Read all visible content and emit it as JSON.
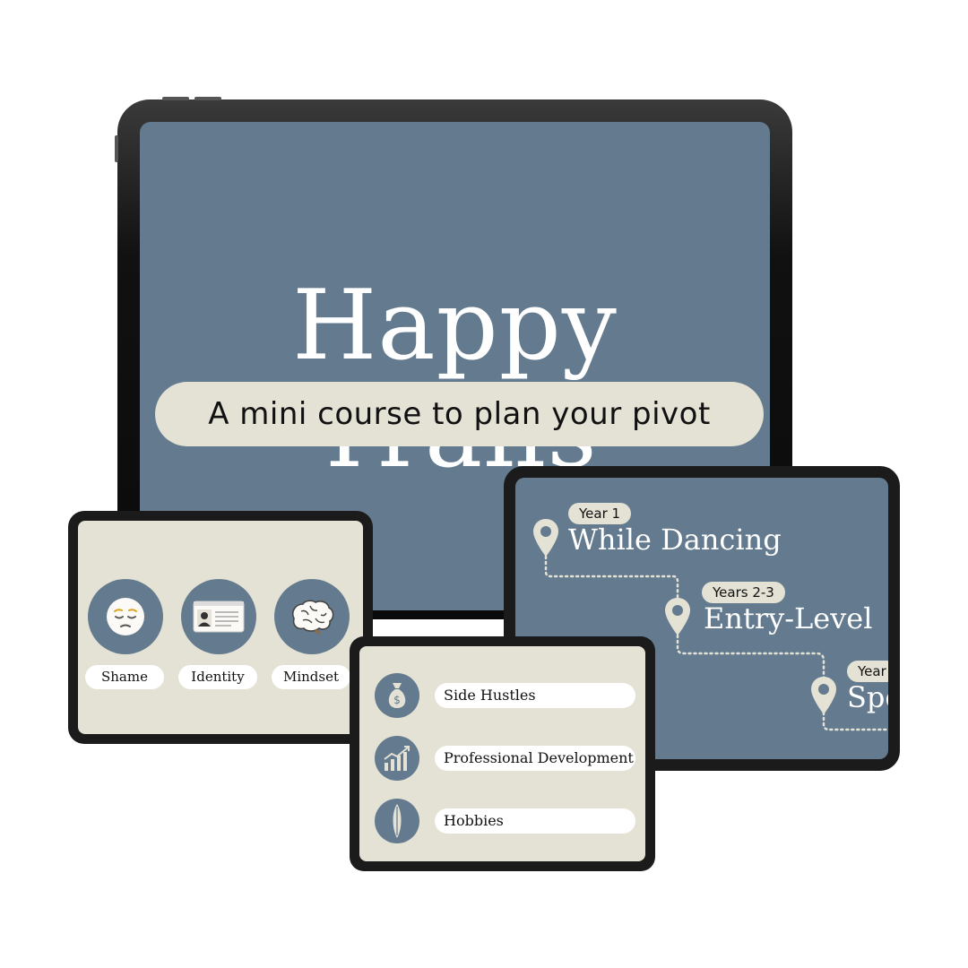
{
  "main_slide": {
    "title": "Happy Trails",
    "subtitle": "A mini course to plan your pivot"
  },
  "topics_slide": {
    "items": [
      {
        "label": "Shame",
        "icon": "pensive-face-icon"
      },
      {
        "label": "Identity",
        "icon": "id-card-icon"
      },
      {
        "label": "Mindset",
        "icon": "brain-icon"
      }
    ]
  },
  "timeline_slide": {
    "steps": [
      {
        "tag": "Year 1",
        "title": "While Dancing",
        "icon": "map-pin-icon"
      },
      {
        "tag": "Years 2-3",
        "title": "Entry-Level",
        "icon": "map-pin-icon"
      },
      {
        "tag": "Year",
        "title": "Spe",
        "icon": "map-pin-icon"
      }
    ]
  },
  "options_slide": {
    "items": [
      {
        "label": "Side Hustles",
        "icon": "money-bag-icon"
      },
      {
        "label": "Professional Development",
        "icon": "growth-chart-icon"
      },
      {
        "label": "Hobbies",
        "icon": "surfboard-icon"
      }
    ]
  },
  "colors": {
    "slate_blue": "#647b8f",
    "beige": "#e4e1d5",
    "white": "#ffffff",
    "device_frame": "#1b1b1b"
  }
}
